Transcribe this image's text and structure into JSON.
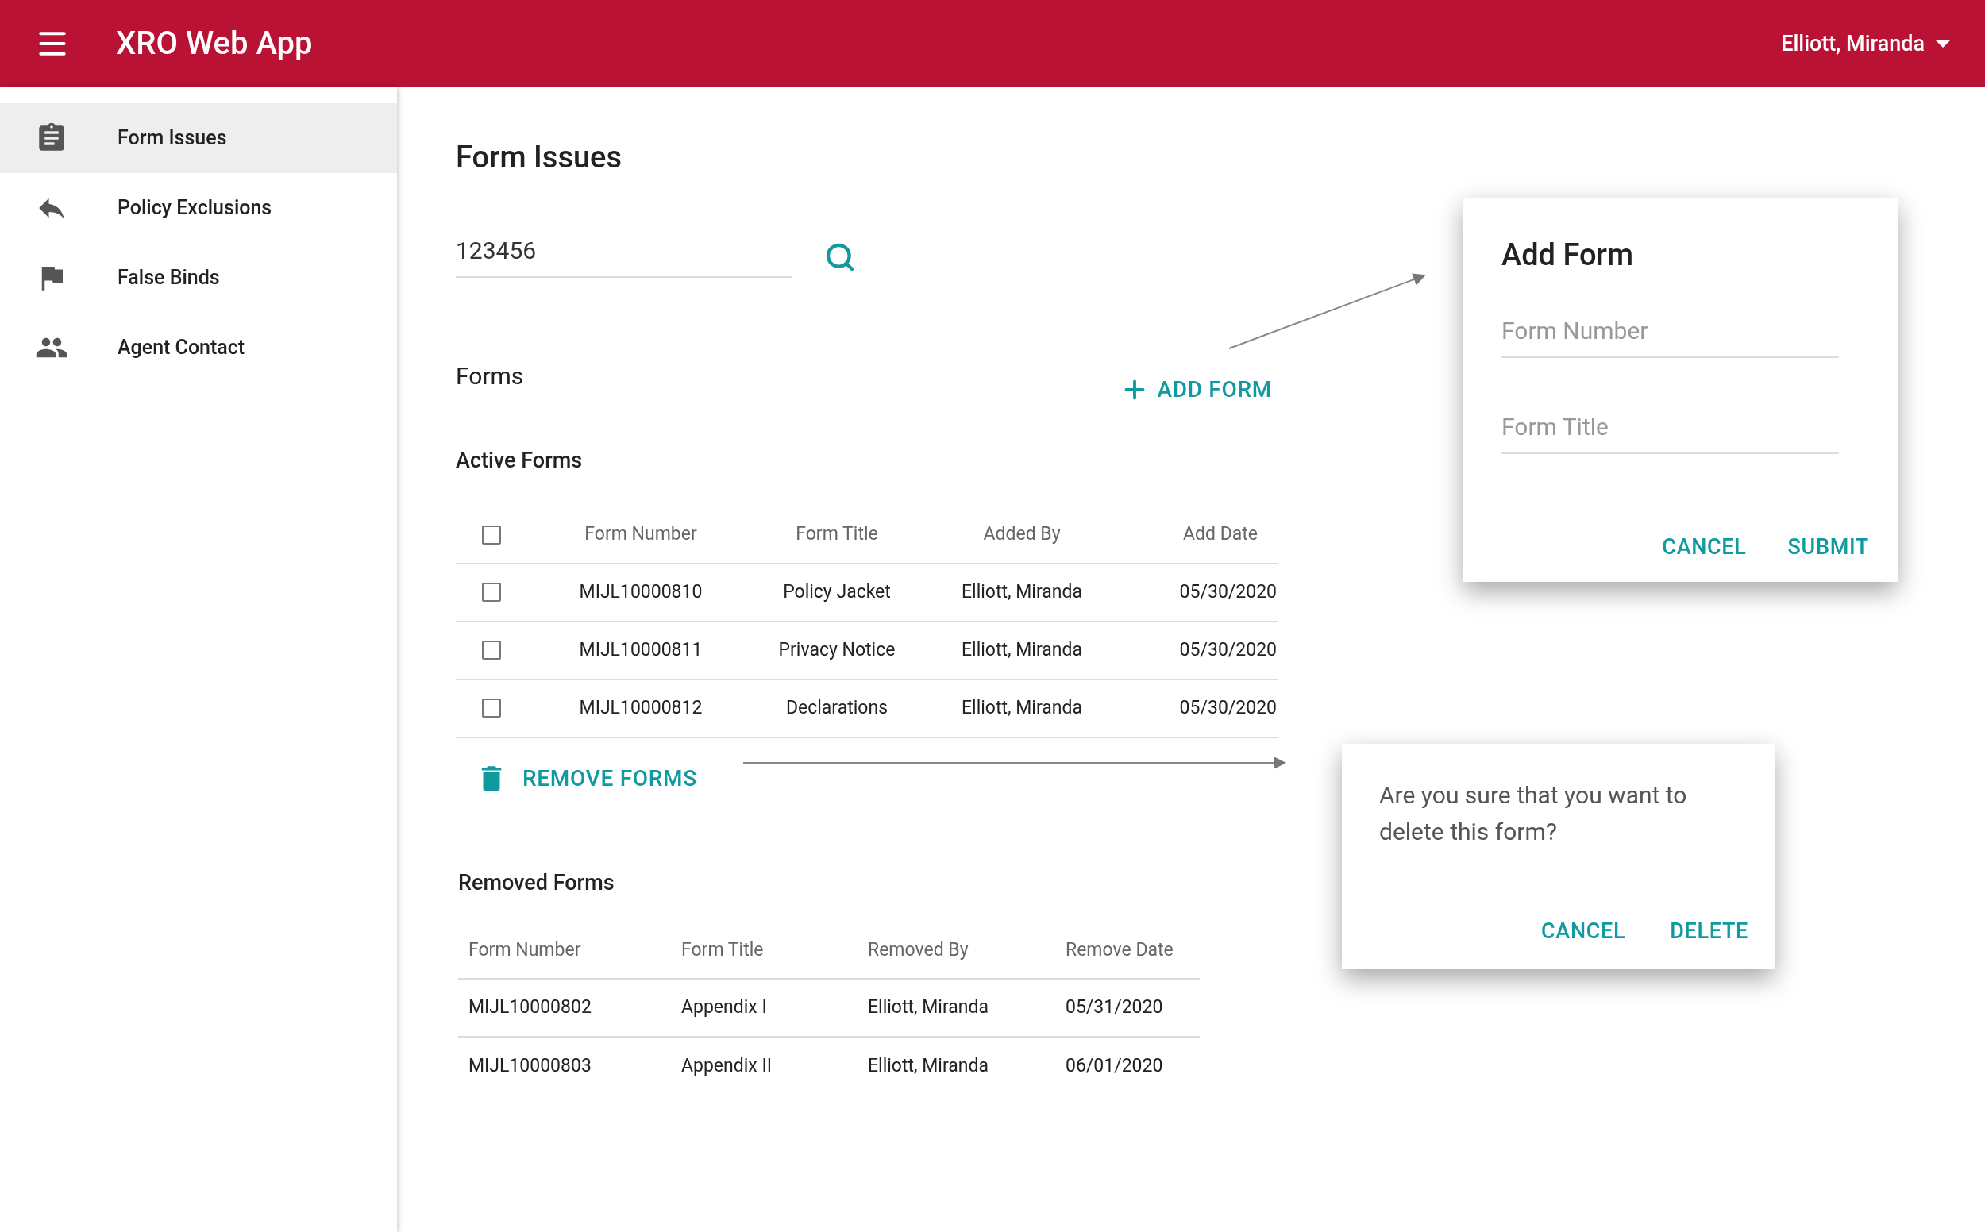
{
  "app": {
    "title": "XRO Web App",
    "user": "Elliott, Miranda"
  },
  "sidebar": {
    "items": [
      {
        "label": "Form Issues",
        "selected": true
      },
      {
        "label": "Policy Exclusions",
        "selected": false
      },
      {
        "label": "False Binds",
        "selected": false
      },
      {
        "label": "Agent Contact",
        "selected": false
      }
    ]
  },
  "page": {
    "title": "Form Issues",
    "search": {
      "value": "123456"
    },
    "forms_heading": "Forms",
    "add_button": "ADD FORM",
    "active": {
      "title": "Active Forms",
      "all_checked": false,
      "columns": [
        "Form Number",
        "Form Title",
        "Added By",
        "Add Date"
      ],
      "rows": [
        {
          "checked": false,
          "cells": [
            "MIJL10000810",
            "Policy Jacket",
            "Elliott, Miranda",
            "05/30/2020"
          ]
        },
        {
          "checked": false,
          "cells": [
            "MIJL10000811",
            "Privacy Notice",
            "Elliott, Miranda",
            "05/30/2020"
          ]
        },
        {
          "checked": false,
          "cells": [
            "MIJL10000812",
            "Declarations",
            "Elliott, Miranda",
            "05/30/2020"
          ]
        }
      ]
    },
    "remove_button": "REMOVE FORMS",
    "removed": {
      "title": "Removed Forms",
      "columns": [
        "Form Number",
        "Form Title",
        "Removed By",
        "Remove Date"
      ],
      "rows": [
        [
          "MIJL10000802",
          "Appendix I",
          "Elliott, Miranda",
          "05/31/2020"
        ],
        [
          "MIJL10000803",
          "Appendix II",
          "Elliott, Miranda",
          "06/01/2020"
        ]
      ]
    }
  },
  "add_dialog": {
    "title": "Add Form",
    "fields": [
      {
        "placeholder": "Form Number"
      },
      {
        "placeholder": "Form Title"
      }
    ],
    "buttons": [
      "CANCEL",
      "SUBMIT"
    ]
  },
  "confirm_dialog": {
    "message": "Are you sure that you want to delete this form?",
    "buttons": [
      "CANCEL",
      "DELETE"
    ]
  }
}
